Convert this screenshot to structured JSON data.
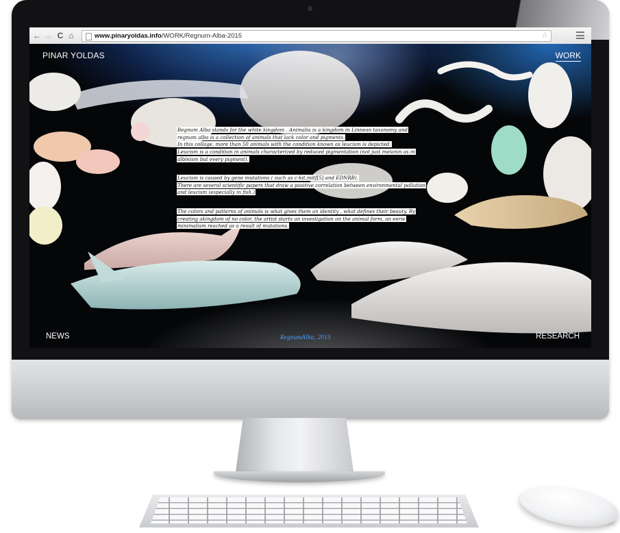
{
  "browser": {
    "back_glyph": "←",
    "forward_glyph": "→",
    "reload_glyph": "C",
    "home_glyph": "⌂",
    "url_host": "www.pinaryoldas.info",
    "url_path": "/WORK/Regnum-Alba-2015",
    "bookmark_glyph": "☆"
  },
  "site": {
    "title": "PINAR YOLDAS",
    "nav_work": "WORK",
    "nav_news": "NEWS",
    "nav_research": "RESEARCH",
    "caption": "RegnumAlba, 2015"
  },
  "body_text": {
    "paragraph_1": [
      "Regnum Alba stands for the white kingdom . Animalia is a kingdom in Linnean taxonomy and",
      "regnum alba is a collection of animals that lack color and pigments.",
      "In this collage, more than 50 animals with the condition known as leucism is depicted.",
      "Leucism is a condition in animals characterized by reduced pigmentation (not just melanin as in",
      "albinism but every pigment)."
    ],
    "paragraph_2": [
      "Leucism is caused by gene mutations ( such as c-kit,mitf[5] and EDNRB).",
      "There are several scientific papers that draw a positive correlation between environmental pollution",
      "and leucism (especially in fish.)"
    ],
    "paragraph_3": [
      "The colors and patterns of animals is what gives them an identity , what defines their beauty. By",
      "creating akingdom of no color, the artist starts an investigation on the animal form, an eerie",
      "minimalism reached as a result of mutations."
    ]
  },
  "colors": {
    "accent_blue": "#4aa3ff",
    "page_background": "#050608",
    "text_highlight": "#ffffff"
  },
  "icons": [
    "back-arrow-icon",
    "forward-arrow-icon",
    "reload-icon",
    "home-icon",
    "page-icon",
    "bookmark-star-icon",
    "menu-icon"
  ]
}
